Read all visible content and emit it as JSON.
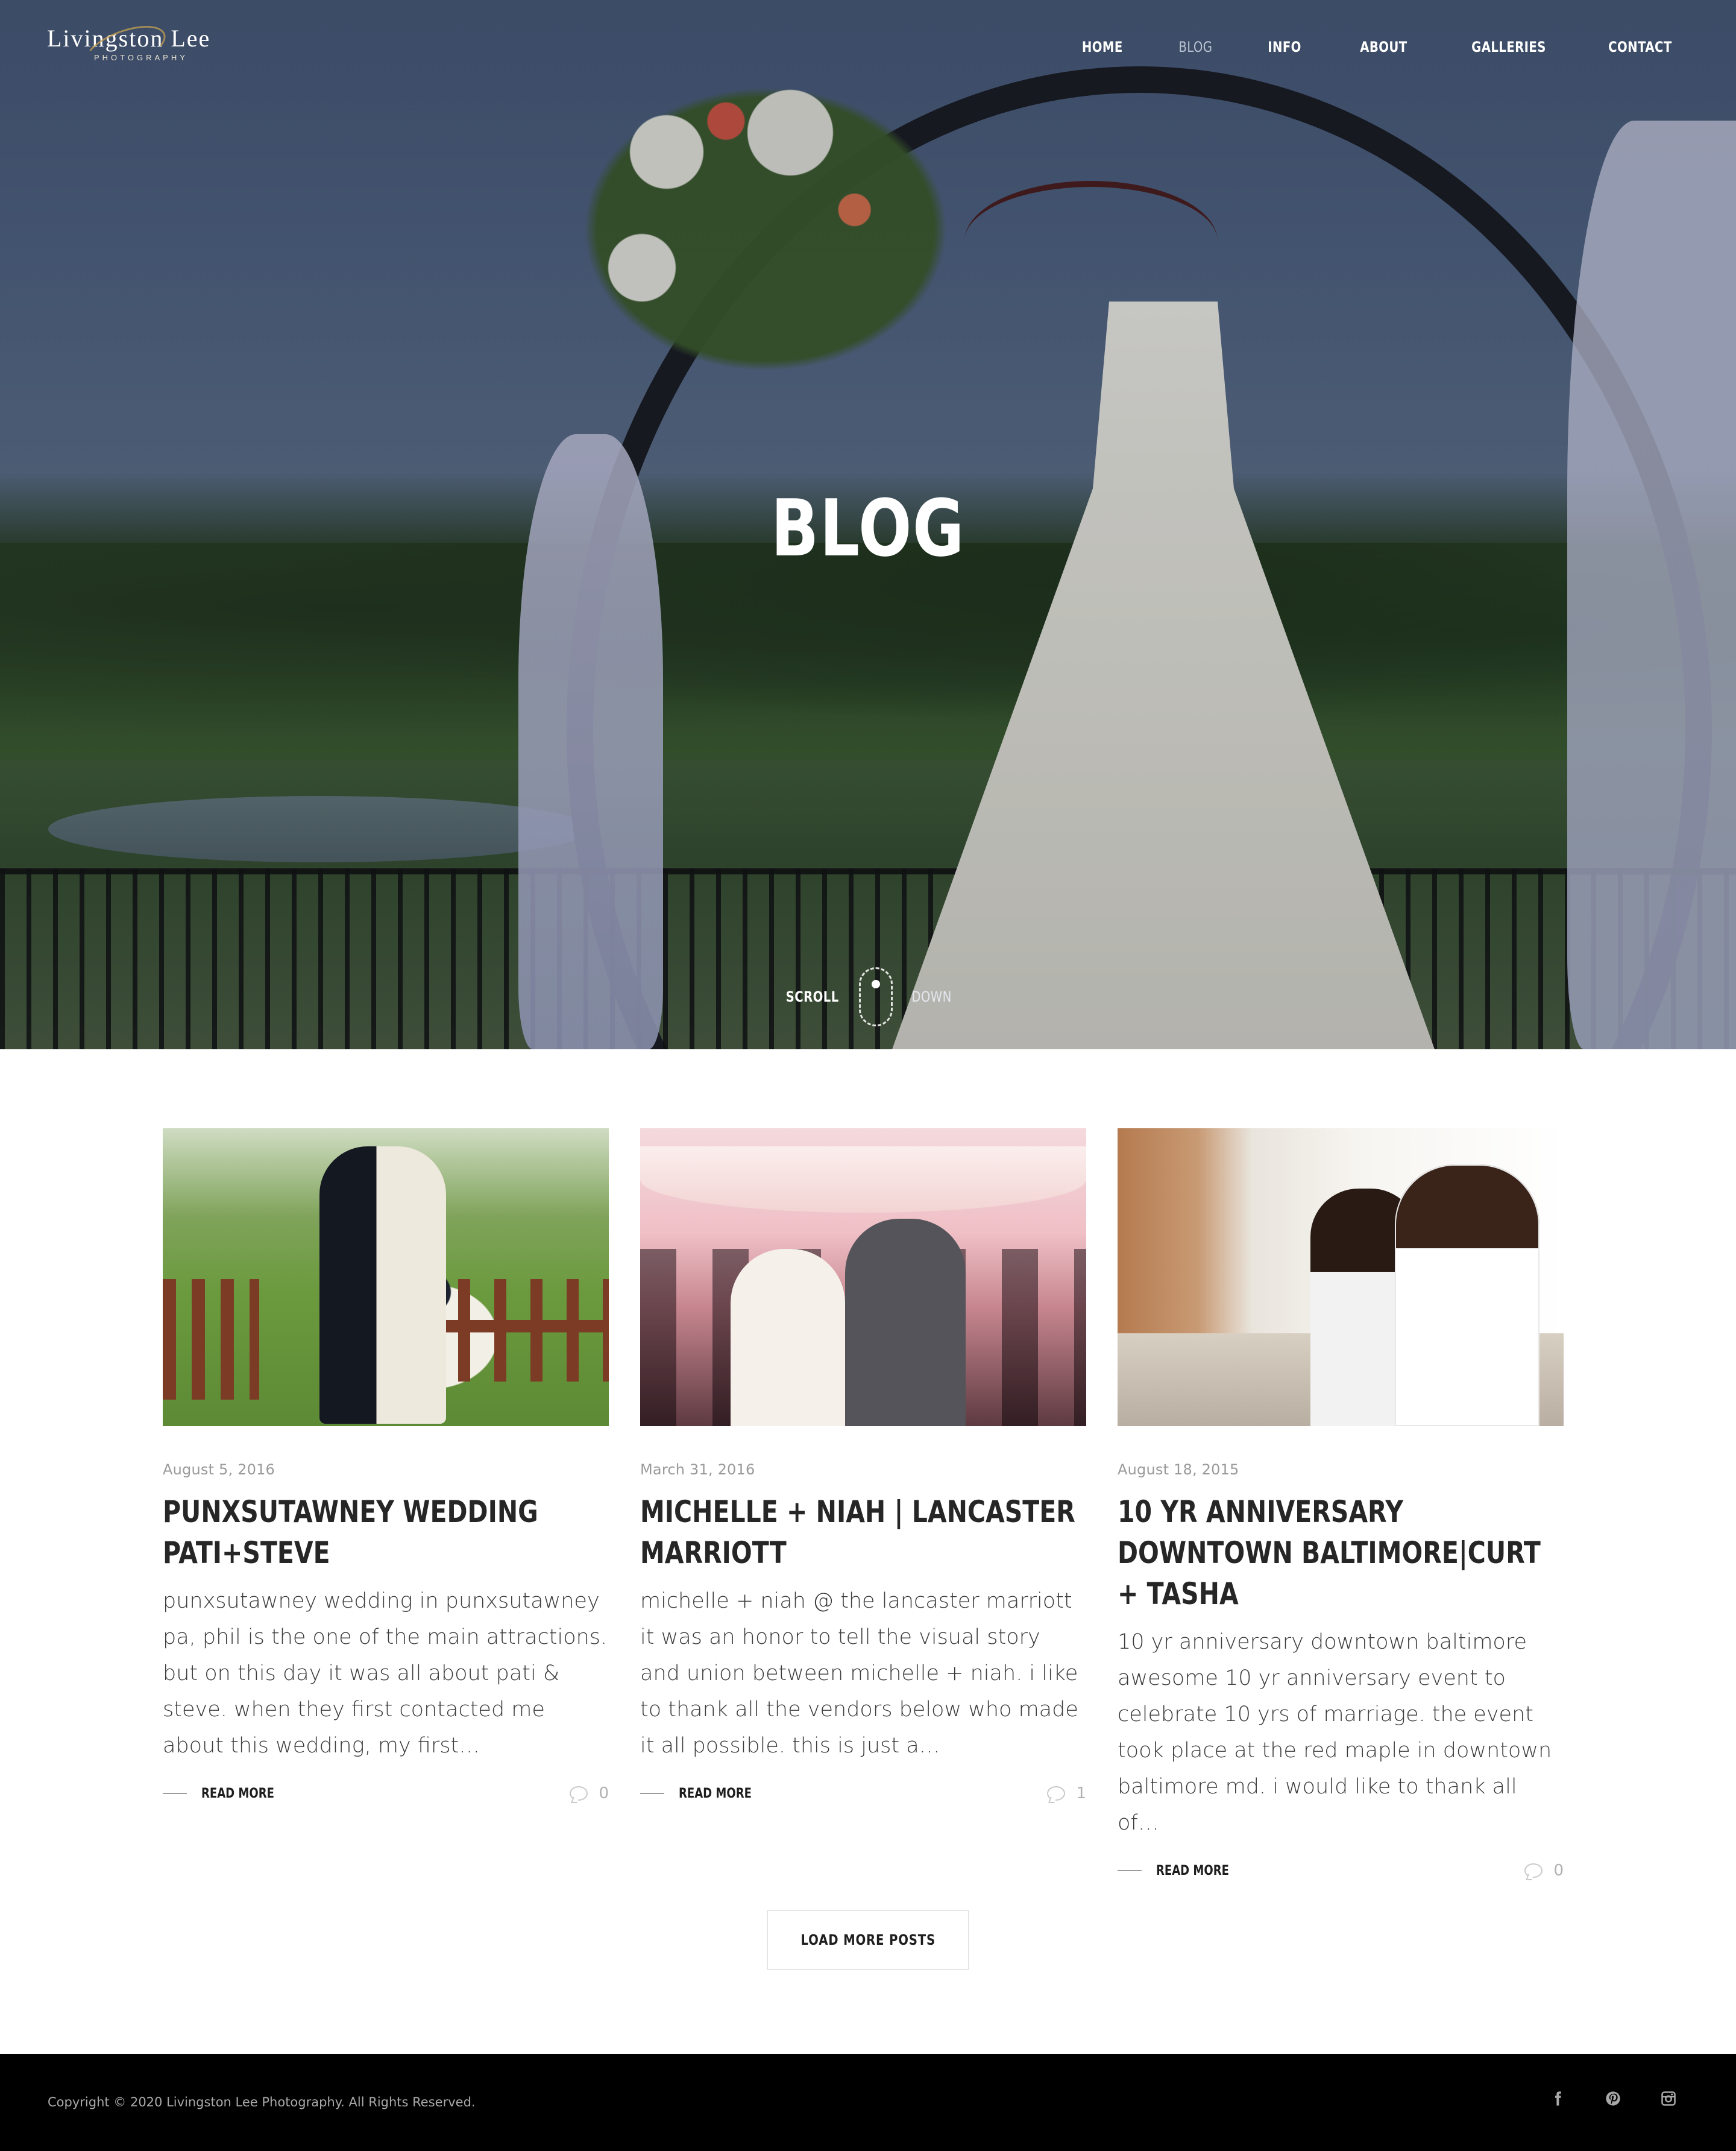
{
  "site": {
    "logo_main": "Livingston Lee",
    "logo_sub": "PHOTOGRAPHY"
  },
  "nav": {
    "items": [
      {
        "label": "HOME",
        "active": false
      },
      {
        "label": "BLOG",
        "active": true
      },
      {
        "label": "INFO",
        "active": false
      },
      {
        "label": "ABOUT",
        "active": false
      },
      {
        "label": "GALLERIES",
        "active": false
      },
      {
        "label": "CONTACT",
        "active": false
      }
    ]
  },
  "hero": {
    "title": "BLOG",
    "scroll_label": "SCROLL",
    "down_label": "DOWN"
  },
  "posts": [
    {
      "date": "August 5, 2016",
      "title": "PUNXSUTAWNEY WEDDING PATI+STEVE",
      "excerpt": "punxsutawney wedding in punxsutawney pa, phil is the one of the main attractions. but on this day it was all about pati & steve. when they first contacted me about this wedding, my first…",
      "read_more": "READ MORE",
      "comments": "0",
      "image_alt": "Bride and groom embracing on a path beside wooden fences"
    },
    {
      "date": "March 31, 2016",
      "title": "MICHELLE + NIAH | LANCASTER MARRIOTT",
      "excerpt": "michelle + niah @ the lancaster marriott it was an honor to tell the visual story and union between michelle + niah. i like to thank all the vendors below who made it all possible. this is just a…",
      "read_more": "READ MORE",
      "comments": "1",
      "image_alt": "Bride and groom walking through reception crowd"
    },
    {
      "date": "August 18, 2015",
      "title": "10 YR ANNIVERSARY DOWNTOWN BALTIMORE|CURT + TASHA",
      "excerpt": "10 yr anniversary downtown baltimore awesome 10 yr anniversary event to celebrate 10 yrs of marriage. the event took place at the red maple in downtown baltimore md. i would like to thank all of…",
      "read_more": "READ MORE",
      "comments": "0",
      "image_alt": "Couple posing together on a city street"
    }
  ],
  "load_more_label": "LOAD MORE POSTS",
  "footer": {
    "copyright": "Copyright © 2020 Livingston Lee Photography. All Rights Reserved.",
    "social": [
      {
        "name": "facebook-icon"
      },
      {
        "name": "pinterest-icon"
      },
      {
        "name": "instagram-icon"
      }
    ]
  }
}
